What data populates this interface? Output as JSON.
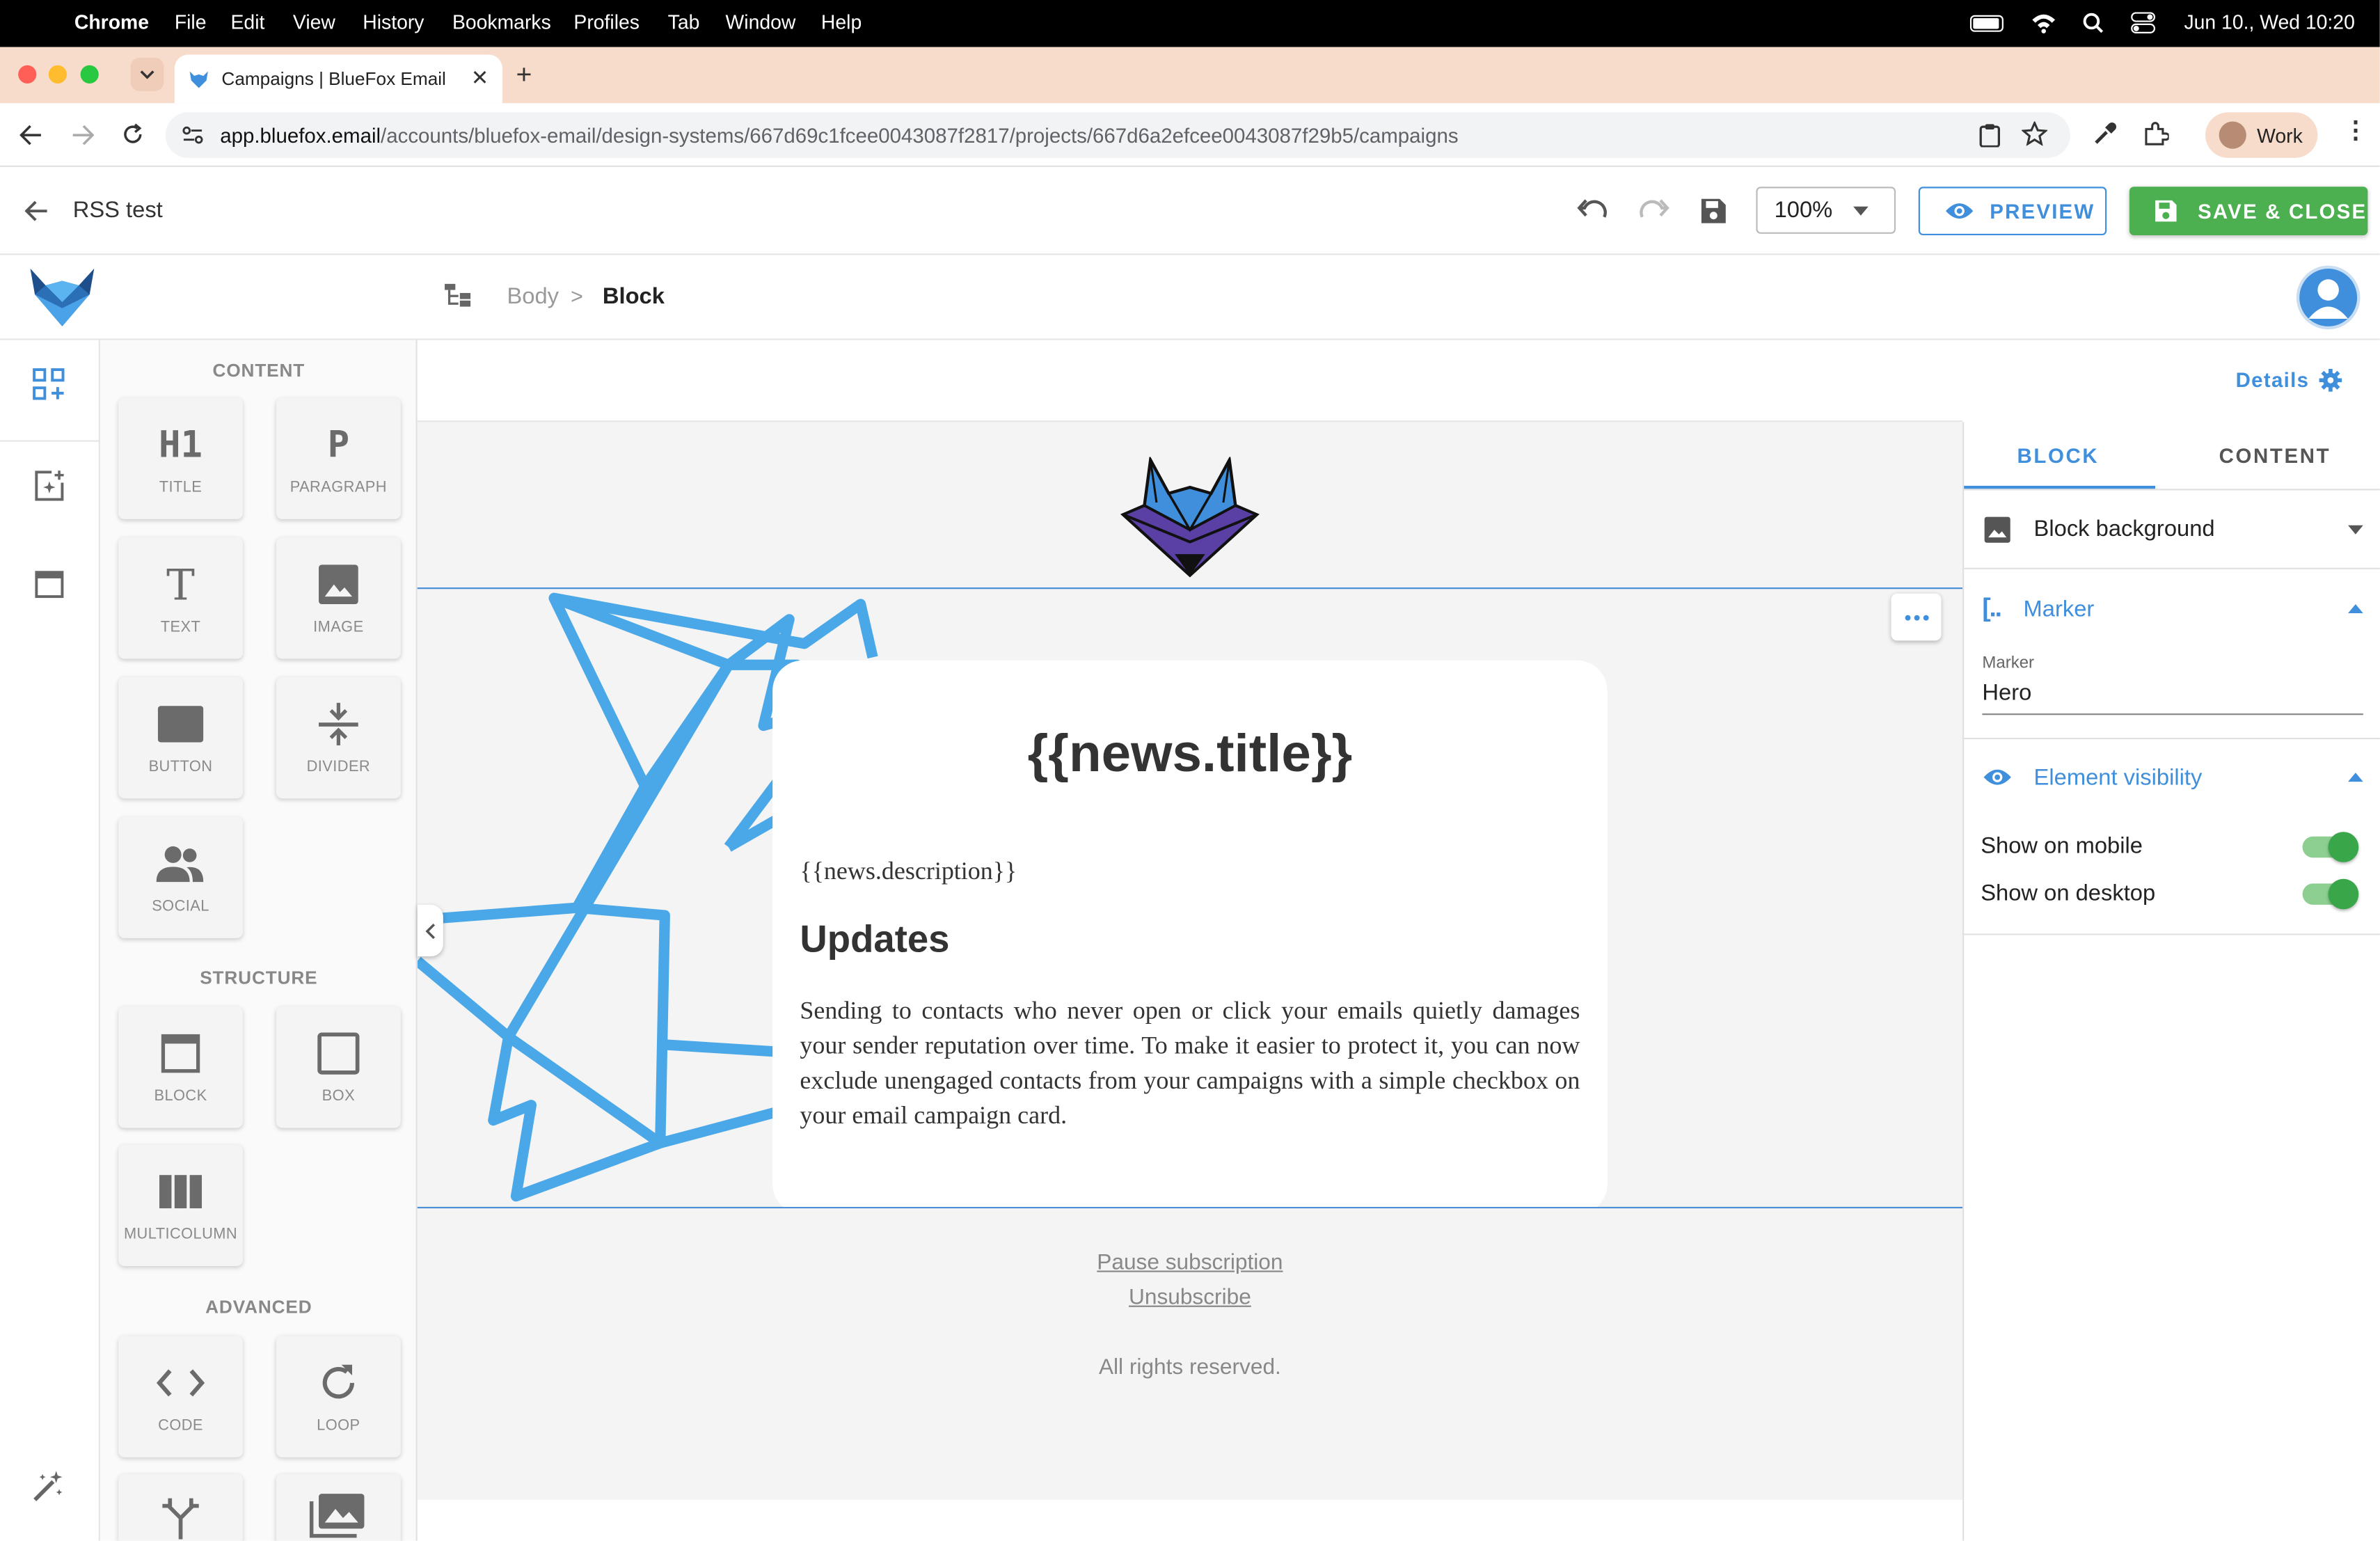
{
  "menubar": {
    "app": "Chrome",
    "items": [
      "File",
      "Edit",
      "View",
      "History",
      "Bookmarks",
      "Profiles",
      "Tab",
      "Window",
      "Help"
    ],
    "datetime": "Jun 10., Wed  10:20"
  },
  "browser": {
    "tab_title": "Campaigns | BlueFox Email",
    "url_host": "app.bluefox.email",
    "url_path": "/accounts/bluefox-email/design-systems/667d69c1fcee0043087f2817/projects/667d6a2efcee0043087f29b5/campaigns",
    "profile": "Work"
  },
  "header": {
    "title": "RSS test",
    "zoom": "100%",
    "preview_label": "PREVIEW",
    "save_label": "SAVE & CLOSE"
  },
  "breadcrumb": {
    "parent": "Body",
    "sep": ">",
    "current": "Block"
  },
  "palette": {
    "content_title": "CONTENT",
    "structure_title": "STRUCTURE",
    "advanced_title": "ADVANCED",
    "content": [
      {
        "glyph": "H1",
        "label": "TITLE"
      },
      {
        "glyph": "P",
        "label": "PARAGRAPH"
      },
      {
        "glyph": "T",
        "label": "TEXT"
      },
      {
        "label": "IMAGE"
      },
      {
        "label": "BUTTON"
      },
      {
        "label": "DIVIDER"
      },
      {
        "label": "SOCIAL"
      }
    ],
    "structure": [
      {
        "label": "BLOCK"
      },
      {
        "label": "BOX"
      },
      {
        "label": "MULTICOLUMN"
      }
    ],
    "advanced": [
      {
        "label": "CODE"
      },
      {
        "label": "LOOP"
      }
    ]
  },
  "canvas": {
    "details_label": "Details",
    "news_title": "{{news.title}}",
    "news_description": "{{news.description}}",
    "updates_heading": "Updates",
    "body_text": "Sending to contacts who never open or click your emails quietly damages your sender reputation over time. To make it easier to protect it, you can now exclude unengaged contacts from your campaigns with a simple checkbox on your email campaign card.",
    "pause_link": "Pause subscription",
    "unsubscribe_link": "Unsubscribe",
    "rights": "All rights reserved."
  },
  "inspector": {
    "tab_block": "BLOCK",
    "tab_content": "CONTENT",
    "block_background": "Block background",
    "marker_section": "Marker",
    "marker_field_label": "Marker",
    "marker_value": "Hero",
    "visibility_section": "Element visibility",
    "show_mobile": "Show on mobile",
    "show_desktop": "Show on desktop",
    "show_mobile_on": true,
    "show_desktop_on": true
  },
  "colors": {
    "accent": "#3f8fdc",
    "save_green": "#4caf50",
    "toggle_green": "#3aa64a"
  }
}
